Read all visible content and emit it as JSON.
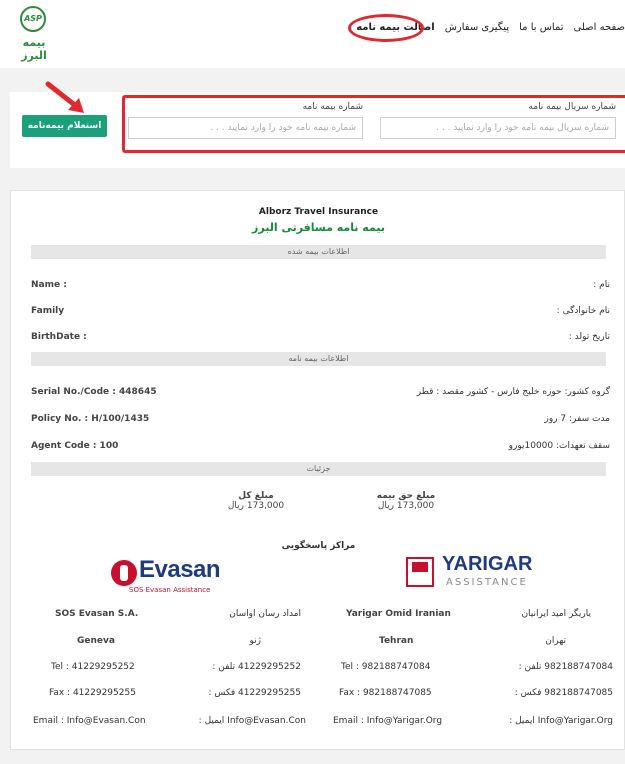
{
  "logo": {
    "mark": "ASP",
    "text": "بیمه البرز"
  },
  "nav": [
    "صفحه اصلی",
    "تماس با ما",
    "پیگیری سفارش",
    "اصالت بیمه نامه"
  ],
  "search": {
    "serial_label": "شماره سریال بیمه نامه",
    "serial_placeholder": "شماره سریال بیمه نامه خود را وارد نمایید . . .",
    "policy_label": "شماره بیمه نامه",
    "policy_placeholder": "شماره بیمه نامه خود را وارد نمایید . . .",
    "submit_label": "استعلام بیمه‌نامه"
  },
  "policy": {
    "title_en": "Alborz Travel Insurance",
    "title_fa": "بیمه نامه مسافرتی البرز",
    "insured_band": "اطلاعات بیمه شده",
    "policy_band": "اطلاعات بیمه نامه",
    "details_band": "جزئیات",
    "name_en": "Name :",
    "name_fa": "نام :",
    "family_en": "Family",
    "family_fa": "نام خانوادگی :",
    "birth_en": "BirthDate :",
    "birth_fa": "تاریخ تولد :",
    "serial_en": "Serial No./Code :  448645",
    "group_fa": "گروه کشور: حوزه خلیج فارس - کشور مقصد : قطر",
    "policyno_en": "Policy No. :  H/100/1435",
    "duration_fa": "مدت سفر:  7 روز",
    "agent_en": "Agent Code :  100",
    "ceiling_fa": "سقف تعهدات:  10000یورو",
    "total_label": "مبلغ کل",
    "total_value": "173,000 ریال",
    "premium_label": "مبلغ حق بیمه",
    "premium_value": "173,000 ریال",
    "centers_label": "مراکز پاسخگویی"
  },
  "evasan": {
    "brand": "Evasan",
    "sub": "SOS Evasan Assistance",
    "name_en": "SOS Evasan S.A.",
    "name_fa": "امداد رسان اواسان",
    "city_en": "Geneva",
    "city_fa": "ژنو",
    "tel_en": "Tel :  41229295252",
    "tel_fa": "41229295252  تلفن :",
    "fax_en": "Fax :  41229295255",
    "fax_fa": "41229295255  فکس :",
    "email_en": "Email :  Info@Evasan.Con",
    "email_fa": "Info@Evasan.Con  ایمیل :"
  },
  "yarigar": {
    "brand": "YARIGAR",
    "sub": "ASSISTANCE",
    "name_en": "Yarigar Omid Iranian",
    "name_fa": "یاریگر امید ایرانیان",
    "city_en": "Tehran",
    "city_fa": "تهران",
    "tel_en": "Tel :  982188747084",
    "tel_fa": "982188747084  تلفن :",
    "fax_en": "Fax :  982188747085",
    "fax_fa": "982188747085  فکس :",
    "email_en": "Email :  Info@Yarigar.Org",
    "email_fa": "Info@Yarigar.Org  ایمیل :"
  },
  "colors": {
    "accent_green": "#1aa07a",
    "highlight_red": "#e0292f",
    "brand_blue": "#1f3b80"
  }
}
